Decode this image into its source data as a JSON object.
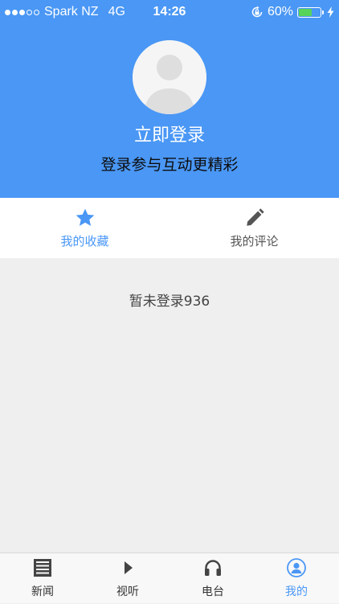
{
  "status_bar": {
    "carrier": "Spark NZ",
    "network": "4G",
    "time": "14:26",
    "battery_percent_label": "60%",
    "battery_level": 0.6
  },
  "profile": {
    "login_title": "立即登录",
    "login_subtitle": "登录参与互动更精彩"
  },
  "tabs": [
    {
      "label": "我的收藏",
      "icon": "star-icon",
      "active": true
    },
    {
      "label": "我的评论",
      "icon": "pencil-icon",
      "active": false
    }
  ],
  "content": {
    "empty_message": "暂未登录936"
  },
  "bottom_nav": [
    {
      "label": "新闻",
      "icon": "newspaper-icon",
      "active": false
    },
    {
      "label": "视听",
      "icon": "play-icon",
      "active": false
    },
    {
      "label": "电台",
      "icon": "headphones-icon",
      "active": false
    },
    {
      "label": "我的",
      "icon": "user-icon",
      "active": true
    }
  ],
  "colors": {
    "accent": "#4a97f5",
    "background": "#efefef",
    "battery_fill": "#57d35a"
  }
}
